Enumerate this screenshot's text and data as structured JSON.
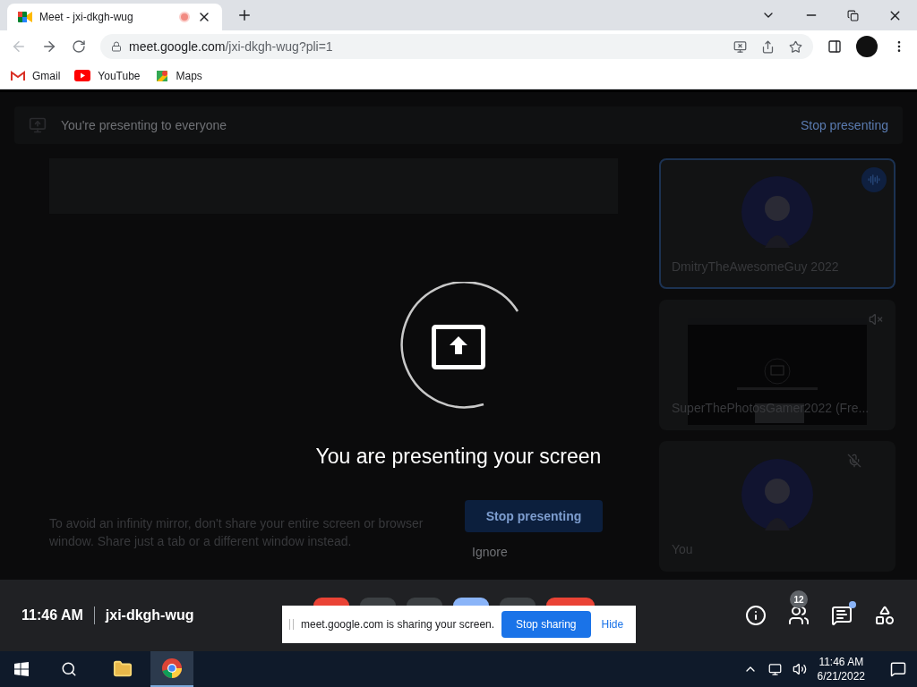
{
  "browser": {
    "tab_title": "Meet - jxi-dkgh-wug",
    "url_host": "meet.google.com",
    "url_path": "/jxi-dkgh-wug?pli=1",
    "bookmarks": [
      {
        "label": "Gmail",
        "kind": "gmail"
      },
      {
        "label": "YouTube",
        "kind": "youtube"
      },
      {
        "label": "Maps",
        "kind": "maps"
      }
    ]
  },
  "meet": {
    "header": {
      "text": "You're presenting to everyone",
      "action": "Stop presenting"
    },
    "warning": "To avoid an infinity mirror, don't share your entire screen or browser window. Share just a tab or a different window instead.",
    "stop_button": "Stop presenting",
    "ignore": "Ignore",
    "overlay_message": "You are presenting your screen",
    "tiles": [
      {
        "name": "DmitryTheAwesomeGuy 2022",
        "indicator": {
          "kind": "speaking"
        },
        "selected": true
      },
      {
        "name": "SuperThePhotosGamer2022 (Fre...",
        "kind": "screen",
        "indicator": {
          "kind": "audio_off"
        },
        "selected": false
      },
      {
        "name": "You",
        "indicator": {
          "kind": "mic_off"
        },
        "selected": false
      }
    ],
    "bottom_bar": {
      "time": "11:46 AM",
      "code": "jxi-dkgh-wug",
      "people_count": "12",
      "chat_unread": true
    }
  },
  "share_bar": {
    "text": "meet.google.com is sharing your screen.",
    "stop": "Stop sharing",
    "hide": "Hide"
  },
  "taskbar": {
    "time": "11:46 AM",
    "date": "6/21/2022"
  }
}
